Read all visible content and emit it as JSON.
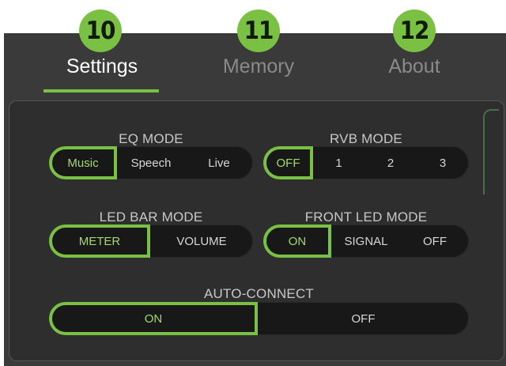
{
  "callouts": [
    "10",
    "11",
    "12"
  ],
  "tabs": [
    {
      "label": "Settings",
      "active": true
    },
    {
      "label": "Memory",
      "active": false
    },
    {
      "label": "About",
      "active": false
    }
  ],
  "colors": {
    "accent": "#7ac143",
    "background": "#3a3a3a",
    "control": "#181818"
  },
  "eq_mode": {
    "title": "EQ MODE",
    "options": [
      "Music",
      "Speech",
      "Live"
    ],
    "selected": "Music"
  },
  "rvb_mode": {
    "title": "RVB MODE",
    "options": [
      "OFF",
      "1",
      "2",
      "3"
    ],
    "selected": "OFF"
  },
  "led_bar_mode": {
    "title": "LED BAR MODE",
    "options": [
      "METER",
      "VOLUME"
    ],
    "selected": "METER"
  },
  "front_led_mode": {
    "title": "FRONT LED MODE",
    "options": [
      "ON",
      "SIGNAL",
      "OFF"
    ],
    "selected": "ON"
  },
  "auto_connect": {
    "title": "AUTO-CONNECT",
    "options": [
      "ON",
      "OFF"
    ],
    "selected": "ON"
  }
}
